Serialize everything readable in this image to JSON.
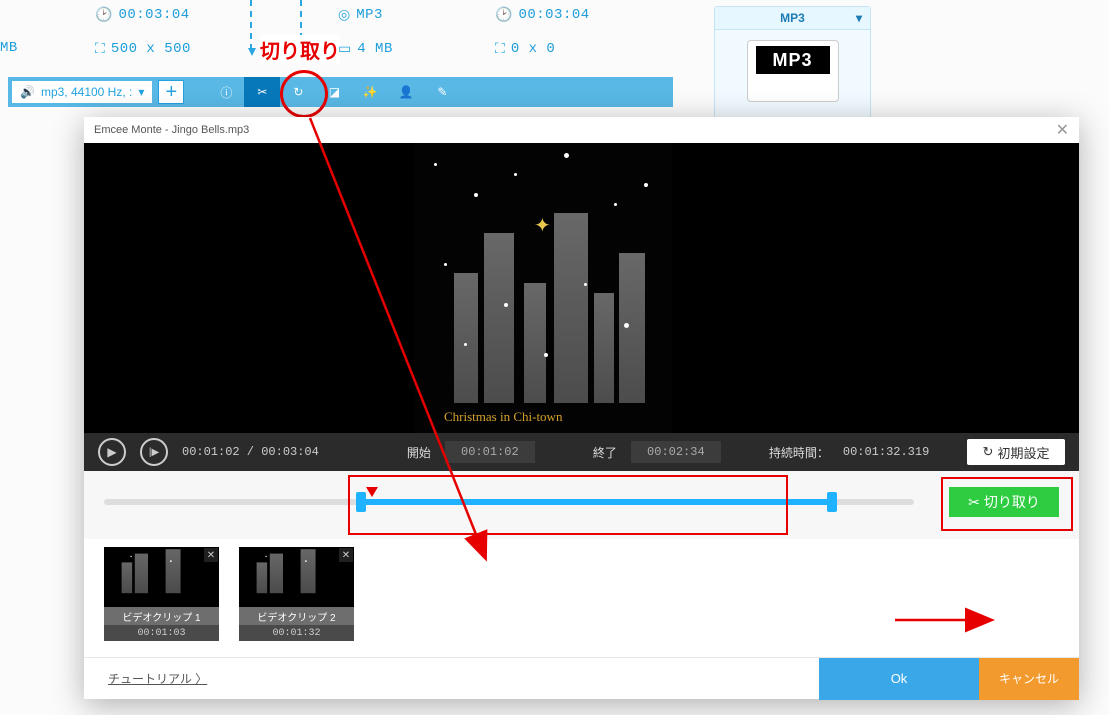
{
  "top": {
    "duration_left": "00:03:04",
    "dimensions_left": "500 x 500",
    "mb_left": "MB",
    "format": "MP3",
    "size_right": "4 MB",
    "duration_right": "00:03:04",
    "dimensions_right": "0 x 0",
    "audio_info": "mp3, 44100 Hz, :",
    "label_cut": "切り取り"
  },
  "right": {
    "format": "MP3",
    "badge": "MP3"
  },
  "dialog": {
    "title": "Emcee Monte - Jingo Bells.mp3",
    "scene_text": "Christmas in Chi-town",
    "controls": {
      "position": "00:01:02 / 00:03:04",
      "start_label": "開始",
      "start_value": "00:01:02",
      "end_label": "終了",
      "end_value": "00:02:34",
      "duration_label": "持続時間：",
      "duration_value": "00:01:32.319",
      "reset": "初期設定"
    },
    "cut_label": "切り取り",
    "clips": [
      {
        "label": "ビデオクリップ 1",
        "time": "00:01:03"
      },
      {
        "label": "ビデオクリップ 2",
        "time": "00:01:32"
      }
    ],
    "footer": {
      "tutorial": "チュートリアル",
      "ok": "Ok",
      "cancel": "キャンセル"
    }
  }
}
